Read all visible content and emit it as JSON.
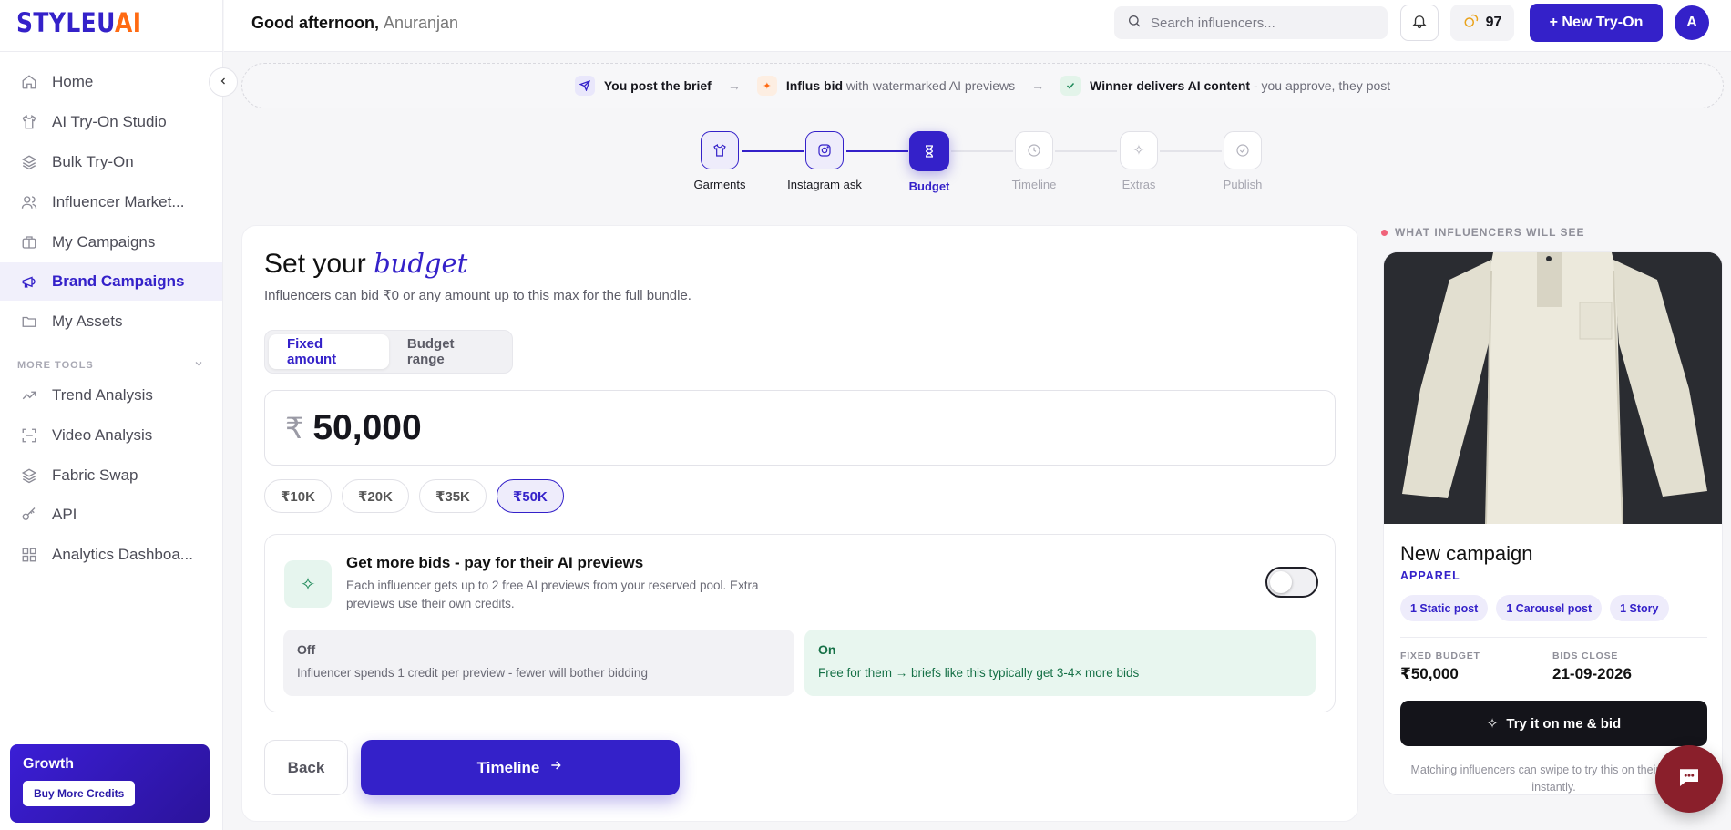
{
  "brand": {
    "part1": "STYLEU",
    "part2": "AI"
  },
  "sidebar": {
    "items": [
      {
        "label": "Home",
        "icon": "home-icon"
      },
      {
        "label": "AI Try-On Studio",
        "icon": "shirt-icon"
      },
      {
        "label": "Bulk Try-On",
        "icon": "layers-icon"
      },
      {
        "label": "Influencer Market...",
        "icon": "users-icon"
      },
      {
        "label": "My Campaigns",
        "icon": "briefcase-icon"
      },
      {
        "label": "Brand Campaigns",
        "icon": "megaphone-icon",
        "active": true
      },
      {
        "label": "My Assets",
        "icon": "folder-icon"
      }
    ],
    "section_label": "MORE TOOLS",
    "tools": [
      {
        "label": "Trend Analysis",
        "icon": "trending-up-icon"
      },
      {
        "label": "Video Analysis",
        "icon": "scan-icon"
      },
      {
        "label": "Fabric Swap",
        "icon": "layers-icon"
      },
      {
        "label": "API",
        "icon": "key-icon"
      },
      {
        "label": "Analytics Dashboa...",
        "icon": "grid-icon"
      }
    ],
    "growth": {
      "title": "Growth",
      "button": "Buy More Credits"
    }
  },
  "header": {
    "greeting": "Good afternoon,",
    "user_name": "Anuranjan",
    "search_placeholder": "Search influencers...",
    "credits": "97",
    "new_button": "+ New Try-On",
    "avatar_initial": "A"
  },
  "strip": {
    "step1_bold": "You post the brief",
    "step2_bold": "Influs bid",
    "step2_rest": "with watermarked AI previews",
    "step3_bold": "Winner delivers AI content",
    "step3_rest": "- you approve, they post",
    "arrow": "→"
  },
  "stepper": {
    "steps": [
      {
        "label": "Garments",
        "state": "done"
      },
      {
        "label": "Instagram ask",
        "state": "done"
      },
      {
        "label": "Budget",
        "state": "current"
      },
      {
        "label": "Timeline",
        "state": "todo"
      },
      {
        "label": "Extras",
        "state": "todo"
      },
      {
        "label": "Publish",
        "state": "todo"
      }
    ]
  },
  "budget": {
    "title_plain": "Set your",
    "title_em": "budget",
    "subtitle": "Influencers can bid ₹0 or any amount up to this max for the full bundle.",
    "mode_fixed": "Fixed amount",
    "mode_range": "Budget range",
    "selected_mode": "fixed",
    "currency": "₹",
    "amount": "50,000",
    "presets": [
      "₹10K",
      "₹20K",
      "₹35K",
      "₹50K"
    ],
    "selected_preset": "₹50K"
  },
  "bids": {
    "title": "Get more bids - pay for their AI previews",
    "desc": "Each influencer gets up to 2 free AI previews from your reserved pool. Extra previews use their own credits.",
    "toggle_on": false,
    "off_title": "Off",
    "off_desc": "Influencer spends 1 credit per preview - fewer will bother bidding",
    "on_title": "On",
    "on_desc": "Free for them → briefs like this typically get 3-4× more bids"
  },
  "actions": {
    "back": "Back",
    "next": "Timeline"
  },
  "preview": {
    "label": "WHAT INFLUENCERS WILL SEE",
    "title": "New campaign",
    "category": "APPAREL",
    "tags": [
      "1 Static post",
      "1 Carousel post",
      "1 Story"
    ],
    "budget_key": "FIXED BUDGET",
    "budget_val": "₹50,000",
    "close_key": "BIDS CLOSE",
    "close_val": "21-09-2026",
    "button": "Try it on me & bid",
    "note": "Matching influencers can swipe to try this on their photos instantly."
  },
  "colors": {
    "accent": "#3421c9",
    "orange": "#ff6a12",
    "green": "#157046"
  }
}
